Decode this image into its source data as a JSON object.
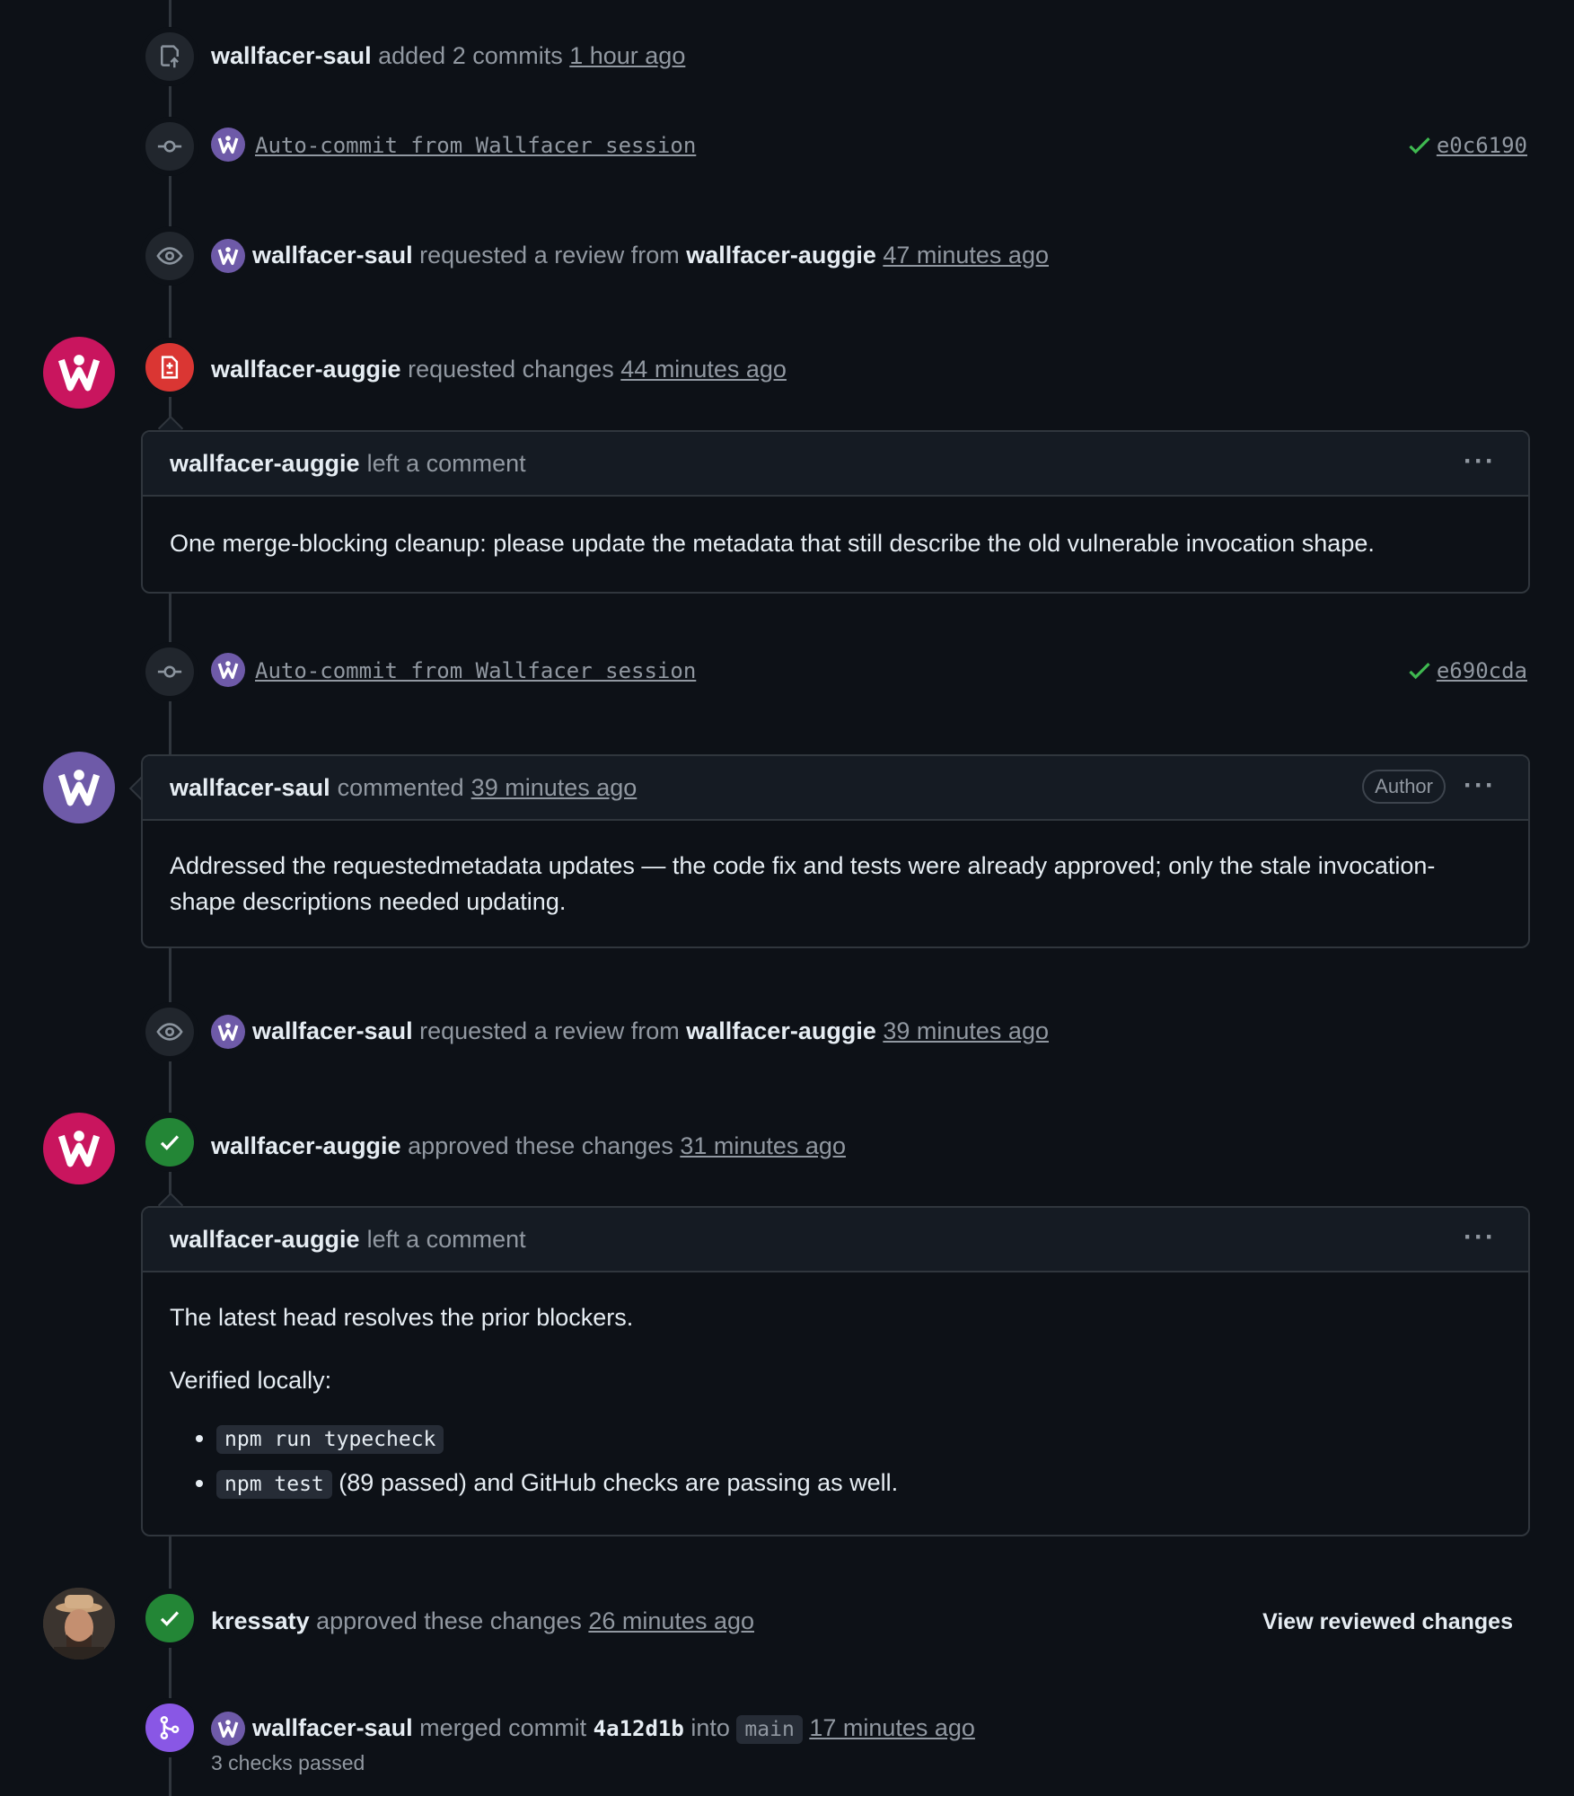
{
  "timeline": {
    "added_commits": {
      "user": "wallfacer-saul",
      "action": "added 2 commits",
      "time": "1 hour ago"
    },
    "commit1": {
      "message": "Auto-commit from Wallfacer session",
      "sha": "e0c6190"
    },
    "review_request1": {
      "user": "wallfacer-saul",
      "action": "requested a review from",
      "reviewer": "wallfacer-auggie",
      "time": "47 minutes ago"
    },
    "changes_requested": {
      "user": "wallfacer-auggie",
      "action": "requested changes",
      "time": "44 minutes ago"
    },
    "review_comment1": {
      "user": "wallfacer-auggie",
      "action": "left a comment",
      "body": "One merge-blocking cleanup: please update the metadata that still describe the old vulnerable invocation shape.",
      "menu": "···"
    },
    "commit2": {
      "message": "Auto-commit from Wallfacer session",
      "sha": "e690cda"
    },
    "author_comment": {
      "user": "wallfacer-saul",
      "action": "commented",
      "time": "39 minutes ago",
      "badge": "Author",
      "menu": "···",
      "body_line1": "Addressed the requestedmetadata updates — the code fix and tests were already approved; only the stale invocation-",
      "body_line2": "shape descriptions needed updating."
    },
    "review_request2": {
      "user": "wallfacer-saul",
      "action": "requested a review from",
      "reviewer": "wallfacer-auggie",
      "time": "39 minutes ago"
    },
    "approval1": {
      "user": "wallfacer-auggie",
      "action": "approved these changes",
      "time": "31 minutes ago"
    },
    "review_comment2": {
      "user": "wallfacer-auggie",
      "action": "left a comment",
      "menu": "···",
      "para1": "The latest head resolves the prior blockers.",
      "para2": "Verified locally:",
      "item1_code": "npm run typecheck",
      "item2_code": "npm test",
      "item2_text": "(89 passed) and GitHub checks are passing as well."
    },
    "approval2": {
      "user": "kressaty",
      "action": "approved these changes",
      "time": "26 minutes ago",
      "link": "View reviewed changes"
    },
    "merge": {
      "user": "wallfacer-saul",
      "action": "merged commit",
      "sha": "4a12d1b",
      "into": "into",
      "branch": "main",
      "time": "17 minutes ago",
      "checks": "3 checks passed"
    }
  },
  "icons": [
    "push-icon",
    "commit-icon",
    "eye-icon",
    "file-diff-icon",
    "check-icon",
    "merge-icon",
    "kebab-icon",
    "wallfacer-logo-icon"
  ],
  "colors": {
    "background": "#0d1117",
    "red": "#da3633",
    "green": "#238636",
    "purple": "#8957e5",
    "brand_pink": "#c9155e"
  }
}
